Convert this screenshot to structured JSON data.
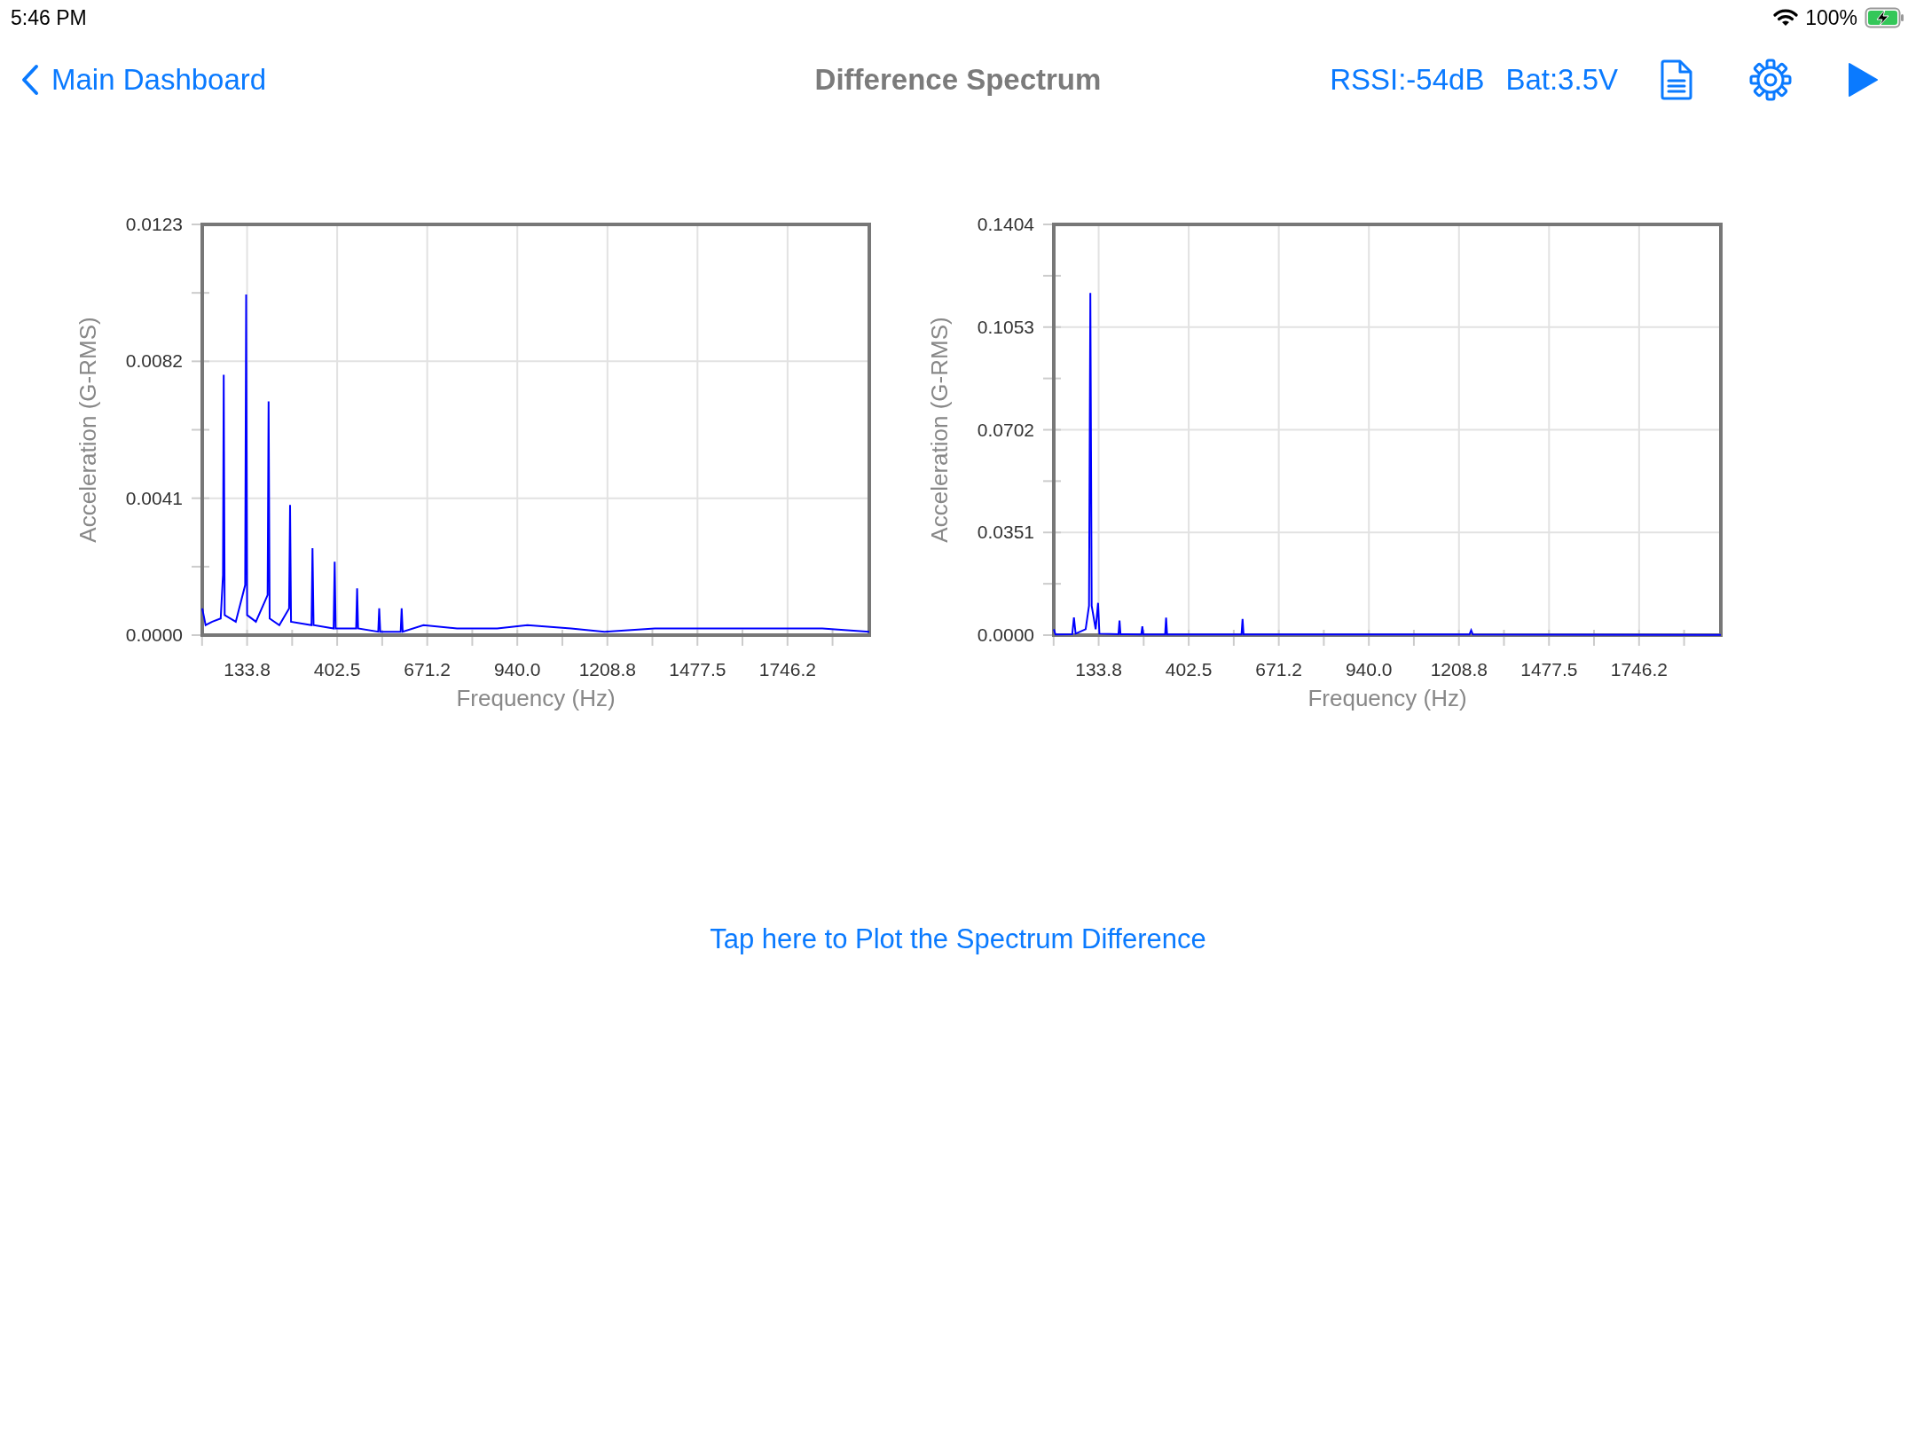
{
  "status_bar": {
    "time": "5:46 PM",
    "battery": "100%"
  },
  "nav_bar": {
    "back": "Main Dashboard",
    "title": "Difference Spectrum",
    "rssi": "RSSI:-54dB",
    "battery": "Bat:3.5V",
    "actions": [
      {
        "kind": "document"
      },
      {
        "kind": "settings"
      },
      {
        "kind": "play"
      }
    ]
  },
  "charts": [
    {
      "chart_data": {
        "type": "line",
        "grid": true,
        "xlabel": "Frequency (Hz)",
        "ylabel": "Acceleration (G-RMS)",
        "xlim": [
          0,
          1990
        ],
        "ylim": [
          0,
          0.0123
        ],
        "xticks": [
          {
            "value": 133.8,
            "label": "133.8"
          },
          {
            "value": 402.5,
            "label": "402.5"
          },
          {
            "value": 671.2,
            "label": "671.2"
          },
          {
            "value": 940,
            "label": "940.0"
          },
          {
            "value": 1208.8,
            "label": "1208.8"
          },
          {
            "value": 1477.5,
            "label": "1477.5"
          },
          {
            "value": 1746.2,
            "label": "1746.2"
          }
        ],
        "yticks": [
          {
            "value": 0,
            "label": "0.0000"
          },
          {
            "value": 0.0041,
            "label": "0.0041"
          },
          {
            "value": 0.0082,
            "label": "0.0082"
          },
          {
            "value": 0.0123,
            "label": "0.0123"
          }
        ],
        "x": [
          0,
          10,
          30,
          55,
          62,
          64,
          67,
          100,
          128,
          131,
          134,
          160,
          195,
          198,
          201,
          230,
          259,
          262,
          265,
          326,
          329,
          332,
          392,
          395,
          398,
          459,
          462,
          465,
          525,
          528,
          531,
          592,
          595,
          598,
          660,
          760,
          880,
          970,
          1100,
          1200,
          1350,
          1480,
          1600,
          1750,
          1850,
          1990
        ],
        "series": [
          {
            "color": "#0000ff",
            "values": [
              0.0008,
              0.0003,
              0.0004,
              0.0005,
              0.0018,
              0.0078,
              0.0006,
              0.0004,
              0.0015,
              0.0102,
              0.0006,
              0.0004,
              0.0012,
              0.007,
              0.0005,
              0.0003,
              0.0008,
              0.0039,
              0.0004,
              0.0003,
              0.0026,
              0.0003,
              0.0002,
              0.0022,
              0.0002,
              0.0002,
              0.0014,
              0.0002,
              0.0001,
              0.0008,
              0.0001,
              0.0001,
              0.0008,
              0.0001,
              0.0003,
              0.0002,
              0.0002,
              0.0003,
              0.0002,
              0.0001,
              0.0002,
              0.0002,
              0.0002,
              0.0002,
              0.0002,
              0.0001
            ]
          }
        ]
      }
    },
    {
      "chart_data": {
        "type": "line",
        "grid": true,
        "xlabel": "Frequency (Hz)",
        "ylabel": "Acceleration (G-RMS)",
        "xlim": [
          0,
          1990
        ],
        "ylim": [
          0,
          0.1404
        ],
        "xticks": [
          {
            "value": 133.8,
            "label": "133.8"
          },
          {
            "value": 402.5,
            "label": "402.5"
          },
          {
            "value": 671.2,
            "label": "671.2"
          },
          {
            "value": 940,
            "label": "940.0"
          },
          {
            "value": 1208.8,
            "label": "1208.8"
          },
          {
            "value": 1477.5,
            "label": "1477.5"
          },
          {
            "value": 1746.2,
            "label": "1746.2"
          }
        ],
        "yticks": [
          {
            "value": 0,
            "label": "0.0000"
          },
          {
            "value": 0.0351,
            "label": "0.0351"
          },
          {
            "value": 0.0702,
            "label": "0.0702"
          },
          {
            "value": 0.1053,
            "label": "0.1053"
          },
          {
            "value": 0.1404,
            "label": "0.1404"
          }
        ],
        "x": [
          0,
          5,
          55,
          60,
          65,
          95,
          105,
          109,
          113,
          125,
          132,
          136,
          193,
          196,
          199,
          261,
          264,
          267,
          332,
          335,
          338,
          560,
          563,
          566,
          700,
          1240,
          1245,
          1250,
          1990
        ],
        "series": [
          {
            "color": "#0000ff",
            "values": [
              0.002,
              0.0002,
              0.0003,
              0.006,
              0.0005,
              0.002,
              0.01,
              0.117,
              0.01,
              0.002,
              0.011,
              0.0005,
              0.0003,
              0.005,
              0.0003,
              0.0002,
              0.003,
              0.0002,
              0.0002,
              0.006,
              0.0002,
              0.0002,
              0.0055,
              0.0002,
              0.0002,
              0.0002,
              0.0017,
              0.0002,
              0.0001
            ]
          }
        ]
      }
    }
  ],
  "plot_link": "Tap here to Plot the Spectrum Difference"
}
